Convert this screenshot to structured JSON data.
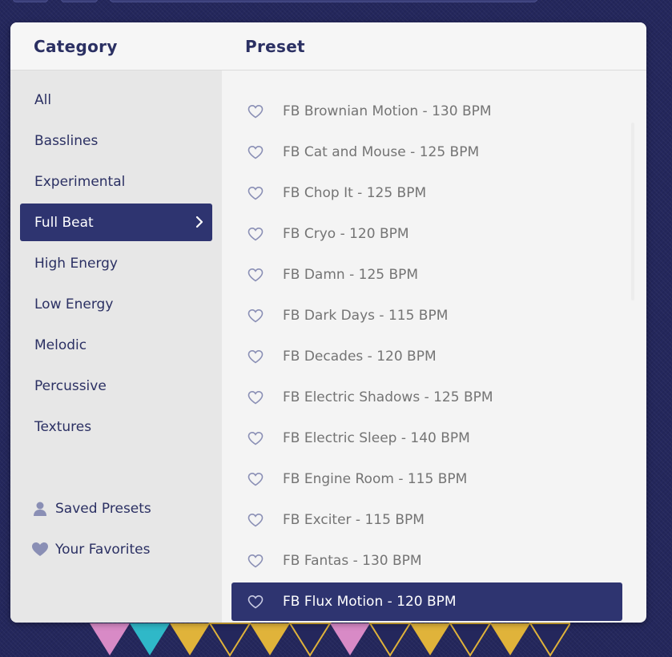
{
  "header": {
    "category_label": "Category",
    "preset_label": "Preset"
  },
  "categories": [
    {
      "label": "All"
    },
    {
      "label": "Basslines"
    },
    {
      "label": "Experimental"
    },
    {
      "label": "Full Beat",
      "selected": true
    },
    {
      "label": "High Energy"
    },
    {
      "label": "Low Energy"
    },
    {
      "label": "Melodic"
    },
    {
      "label": "Percussive"
    },
    {
      "label": "Textures"
    }
  ],
  "sidebar_links": {
    "saved_presets": {
      "label": "Saved Presets",
      "icon": "person-icon"
    },
    "your_favorites": {
      "label": "Your Favorites",
      "icon": "heart-icon"
    }
  },
  "presets": [
    {
      "label": "FB Brownian Motion - 130 BPM"
    },
    {
      "label": "FB Cat and Mouse - 125 BPM"
    },
    {
      "label": "FB Chop It - 125 BPM"
    },
    {
      "label": "FB Cryo - 120 BPM"
    },
    {
      "label": "FB Damn - 125 BPM"
    },
    {
      "label": "FB Dark Days - 115 BPM"
    },
    {
      "label": "FB Decades - 120 BPM"
    },
    {
      "label": "FB Electric Shadows - 125 BPM"
    },
    {
      "label": "FB Electric Sleep - 140 BPM"
    },
    {
      "label": "FB Engine Room - 115 BPM"
    },
    {
      "label": "FB Exciter - 115 BPM"
    },
    {
      "label": "FB Fantas - 130 BPM"
    },
    {
      "label": "FB Flux Motion - 120 BPM",
      "selected": true
    }
  ],
  "colors": {
    "background": "#24275c",
    "accent": "#2e3470",
    "text_dark": "#2b3063",
    "text_muted": "#747474",
    "sidebar_bg": "#e7e7e7",
    "list_bg": "#f4f4f4"
  }
}
